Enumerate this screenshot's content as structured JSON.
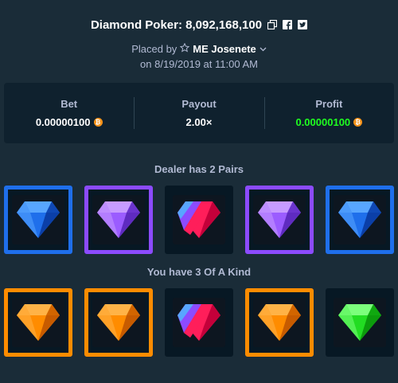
{
  "header": {
    "title": "Diamond Poker: 8,092,168,100",
    "placed_by": "Placed by",
    "user": "ME Josenete",
    "date": "on 8/19/2019 at 11:00 AM"
  },
  "stats": {
    "bet_label": "Bet",
    "bet_value": "0.00000100",
    "payout_label": "Payout",
    "payout_value": "2.00×",
    "profit_label": "Profit",
    "profit_value": "0.00000100",
    "coin_symbol": "₿"
  },
  "dealer": {
    "label": "Dealer has 2 Pairs",
    "gems": [
      "blue",
      "purple",
      "red",
      "purple",
      "blue"
    ]
  },
  "player": {
    "label": "You have 3 Of A Kind",
    "gems": [
      "orange",
      "orange",
      "red",
      "orange",
      "green"
    ]
  },
  "colors": {
    "background": "#1a2c38",
    "panel": "#0f212e",
    "profit": "#1fff20",
    "coin": "#f7931a",
    "blue": "#1f6feb",
    "purple": "#8c4bff",
    "orange": "#ff8c00",
    "green": "#22dd22",
    "red": "#ff1e5a"
  },
  "icons": [
    "copy-icon",
    "facebook-icon",
    "twitter-icon",
    "star-icon",
    "chevron-down-icon",
    "bitcoin-icon"
  ]
}
